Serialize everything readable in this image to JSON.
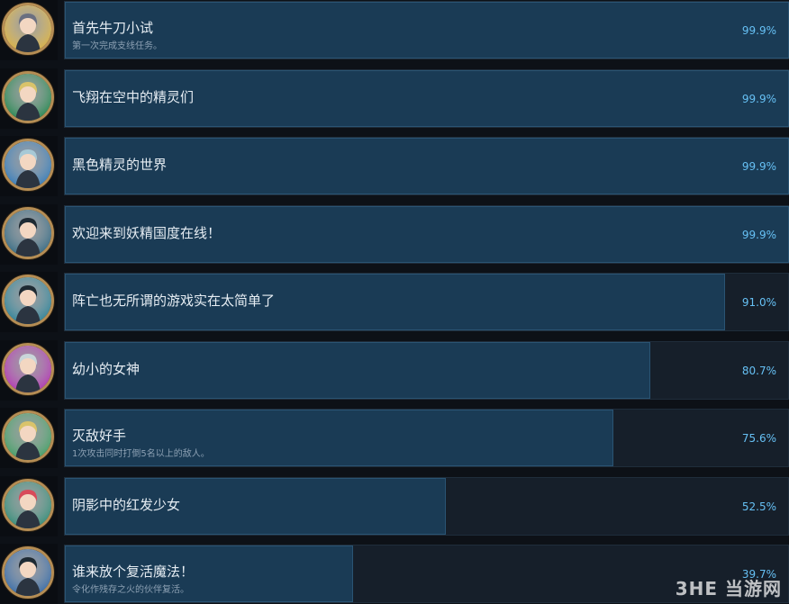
{
  "achievements": [
    {
      "title": "首先牛刀小试",
      "description": "第一次完成支线任务。",
      "percent": "99.9%",
      "fill": 0.999,
      "avatar_color": "#d8b24a",
      "hair": "#6a6f80"
    },
    {
      "title": "飞翔在空中的精灵们",
      "description": "",
      "percent": "99.9%",
      "fill": 0.999,
      "avatar_color": "#2e8a57",
      "hair": "#d9c36a"
    },
    {
      "title": "黑色精灵的世界",
      "description": "",
      "percent": "99.9%",
      "fill": 0.999,
      "avatar_color": "#3d7fb8",
      "hair": "#a7c9d6"
    },
    {
      "title": "欢迎来到妖精国度在线！",
      "description": "",
      "percent": "99.9%",
      "fill": 0.999,
      "avatar_color": "#3c6e86",
      "hair": "#1e2a33"
    },
    {
      "title": "阵亡也无所谓的游戏实在太简单了",
      "description": "",
      "percent": "91.0%",
      "fill": 0.91,
      "avatar_color": "#36869a",
      "hair": "#1e2a33"
    },
    {
      "title": "幼小的女神",
      "description": "",
      "percent": "80.7%",
      "fill": 0.807,
      "avatar_color": "#b23eb3",
      "hair": "#c9d6d9"
    },
    {
      "title": "灭敌好手",
      "description": "1次攻击同时打倒5名以上的敌人。",
      "percent": "75.6%",
      "fill": 0.756,
      "avatar_color": "#49a06a",
      "hair": "#d9c36a"
    },
    {
      "title": "阴影中的红发少女",
      "description": "",
      "percent": "52.5%",
      "fill": 0.525,
      "avatar_color": "#3a8f7b",
      "hair": "#d84a5a"
    },
    {
      "title": "谁来放个复活魔法！",
      "description": "令化作残存之火的伙伴复活。",
      "percent": "39.7%",
      "fill": 0.397,
      "avatar_color": "#3e6fa8",
      "hair": "#1e2a33"
    }
  ],
  "watermark": "3HE 当游网"
}
